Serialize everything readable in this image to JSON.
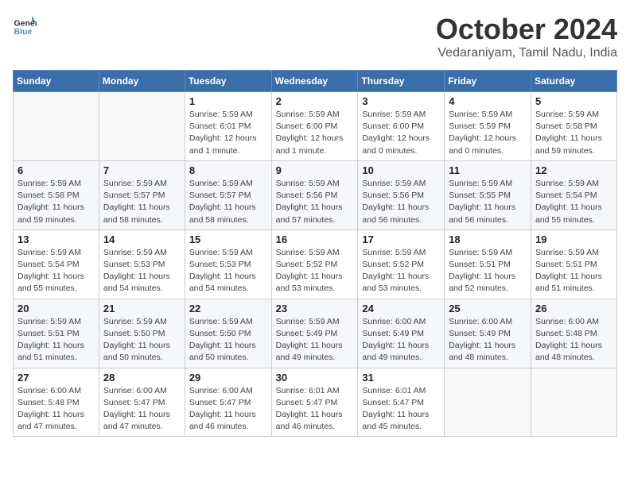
{
  "header": {
    "logo_general": "General",
    "logo_blue": "Blue",
    "month_title": "October 2024",
    "location": "Vedaraniyam, Tamil Nadu, India"
  },
  "weekdays": [
    "Sunday",
    "Monday",
    "Tuesday",
    "Wednesday",
    "Thursday",
    "Friday",
    "Saturday"
  ],
  "weeks": [
    [
      {
        "day": "",
        "info": ""
      },
      {
        "day": "",
        "info": ""
      },
      {
        "day": "1",
        "info": "Sunrise: 5:59 AM\nSunset: 6:01 PM\nDaylight: 12 hours\nand 1 minute."
      },
      {
        "day": "2",
        "info": "Sunrise: 5:59 AM\nSunset: 6:00 PM\nDaylight: 12 hours\nand 1 minute."
      },
      {
        "day": "3",
        "info": "Sunrise: 5:59 AM\nSunset: 6:00 PM\nDaylight: 12 hours\nand 0 minutes."
      },
      {
        "day": "4",
        "info": "Sunrise: 5:59 AM\nSunset: 5:59 PM\nDaylight: 12 hours\nand 0 minutes."
      },
      {
        "day": "5",
        "info": "Sunrise: 5:59 AM\nSunset: 5:58 PM\nDaylight: 11 hours\nand 59 minutes."
      }
    ],
    [
      {
        "day": "6",
        "info": "Sunrise: 5:59 AM\nSunset: 5:58 PM\nDaylight: 11 hours\nand 59 minutes."
      },
      {
        "day": "7",
        "info": "Sunrise: 5:59 AM\nSunset: 5:57 PM\nDaylight: 11 hours\nand 58 minutes."
      },
      {
        "day": "8",
        "info": "Sunrise: 5:59 AM\nSunset: 5:57 PM\nDaylight: 11 hours\nand 58 minutes."
      },
      {
        "day": "9",
        "info": "Sunrise: 5:59 AM\nSunset: 5:56 PM\nDaylight: 11 hours\nand 57 minutes."
      },
      {
        "day": "10",
        "info": "Sunrise: 5:59 AM\nSunset: 5:56 PM\nDaylight: 11 hours\nand 56 minutes."
      },
      {
        "day": "11",
        "info": "Sunrise: 5:59 AM\nSunset: 5:55 PM\nDaylight: 11 hours\nand 56 minutes."
      },
      {
        "day": "12",
        "info": "Sunrise: 5:59 AM\nSunset: 5:54 PM\nDaylight: 11 hours\nand 55 minutes."
      }
    ],
    [
      {
        "day": "13",
        "info": "Sunrise: 5:59 AM\nSunset: 5:54 PM\nDaylight: 11 hours\nand 55 minutes."
      },
      {
        "day": "14",
        "info": "Sunrise: 5:59 AM\nSunset: 5:53 PM\nDaylight: 11 hours\nand 54 minutes."
      },
      {
        "day": "15",
        "info": "Sunrise: 5:59 AM\nSunset: 5:53 PM\nDaylight: 11 hours\nand 54 minutes."
      },
      {
        "day": "16",
        "info": "Sunrise: 5:59 AM\nSunset: 5:52 PM\nDaylight: 11 hours\nand 53 minutes."
      },
      {
        "day": "17",
        "info": "Sunrise: 5:59 AM\nSunset: 5:52 PM\nDaylight: 11 hours\nand 53 minutes."
      },
      {
        "day": "18",
        "info": "Sunrise: 5:59 AM\nSunset: 5:51 PM\nDaylight: 11 hours\nand 52 minutes."
      },
      {
        "day": "19",
        "info": "Sunrise: 5:59 AM\nSunset: 5:51 PM\nDaylight: 11 hours\nand 51 minutes."
      }
    ],
    [
      {
        "day": "20",
        "info": "Sunrise: 5:59 AM\nSunset: 5:51 PM\nDaylight: 11 hours\nand 51 minutes."
      },
      {
        "day": "21",
        "info": "Sunrise: 5:59 AM\nSunset: 5:50 PM\nDaylight: 11 hours\nand 50 minutes."
      },
      {
        "day": "22",
        "info": "Sunrise: 5:59 AM\nSunset: 5:50 PM\nDaylight: 11 hours\nand 50 minutes."
      },
      {
        "day": "23",
        "info": "Sunrise: 5:59 AM\nSunset: 5:49 PM\nDaylight: 11 hours\nand 49 minutes."
      },
      {
        "day": "24",
        "info": "Sunrise: 6:00 AM\nSunset: 5:49 PM\nDaylight: 11 hours\nand 49 minutes."
      },
      {
        "day": "25",
        "info": "Sunrise: 6:00 AM\nSunset: 5:49 PM\nDaylight: 11 hours\nand 48 minutes."
      },
      {
        "day": "26",
        "info": "Sunrise: 6:00 AM\nSunset: 5:48 PM\nDaylight: 11 hours\nand 48 minutes."
      }
    ],
    [
      {
        "day": "27",
        "info": "Sunrise: 6:00 AM\nSunset: 5:48 PM\nDaylight: 11 hours\nand 47 minutes."
      },
      {
        "day": "28",
        "info": "Sunrise: 6:00 AM\nSunset: 5:47 PM\nDaylight: 11 hours\nand 47 minutes."
      },
      {
        "day": "29",
        "info": "Sunrise: 6:00 AM\nSunset: 5:47 PM\nDaylight: 11 hours\nand 46 minutes."
      },
      {
        "day": "30",
        "info": "Sunrise: 6:01 AM\nSunset: 5:47 PM\nDaylight: 11 hours\nand 46 minutes."
      },
      {
        "day": "31",
        "info": "Sunrise: 6:01 AM\nSunset: 5:47 PM\nDaylight: 11 hours\nand 45 minutes."
      },
      {
        "day": "",
        "info": ""
      },
      {
        "day": "",
        "info": ""
      }
    ]
  ]
}
